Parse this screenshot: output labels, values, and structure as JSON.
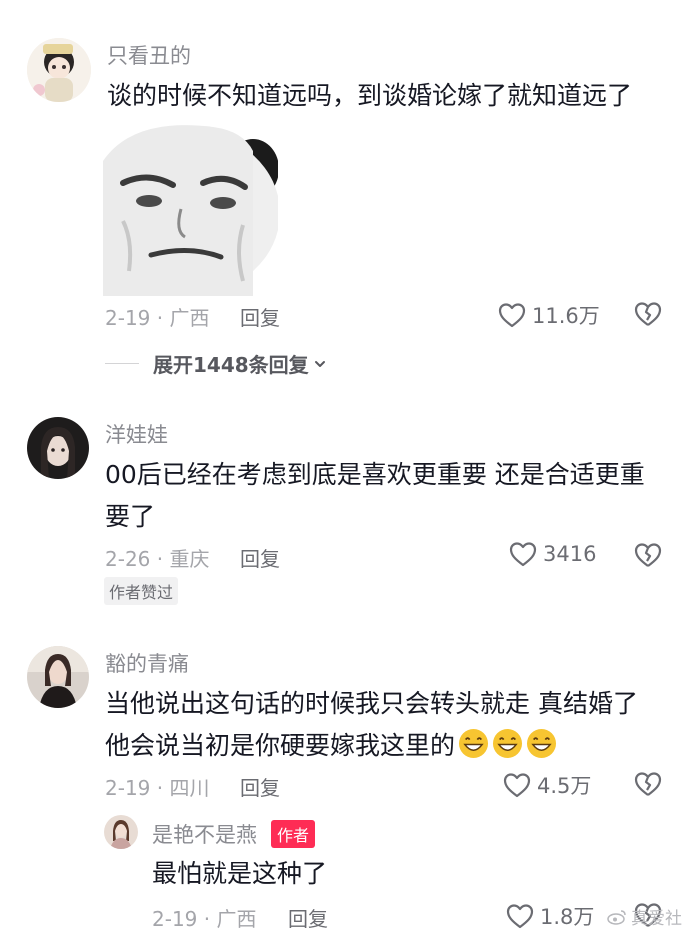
{
  "comments": [
    {
      "username": "只看丑的",
      "text": "谈的时候不知道远吗，到谈婚论嫁了就知道远了",
      "date_location": "2-19 · 广西",
      "reply_label": "回复",
      "like_count": "11.6万",
      "sticker": "panda-meme-sticker",
      "expand_label": "展开1448条回复"
    },
    {
      "username": "洋娃娃",
      "text_line1": "00后已经在考虑到底是喜欢更重要 还是合适更重",
      "text_line2": "要了",
      "date_location": "2-26 · 重庆",
      "reply_label": "回复",
      "like_count": "3416",
      "badge": "作者赞过"
    },
    {
      "username": "豁的青痛",
      "text_line1": "当他说出这句话的时候我只会转头就走 真结婚了",
      "text_line2": "他会说当初是你硬要嫁我这里的",
      "emoji": [
        "grin-emoji",
        "grin-emoji",
        "grin-emoji"
      ],
      "date_location": "2-19 · 四川",
      "reply_label": "回复",
      "like_count": "4.5万"
    }
  ],
  "reply": {
    "username": "是艳不是燕",
    "author_badge": "作者",
    "text": "最怕就是这种了",
    "date_location": "2-19 · 广西",
    "reply_label": "回复",
    "like_count": "1.8万"
  },
  "watermark": "真爱社",
  "colors": {
    "accent": "#fe2c55",
    "text": "#161823",
    "muted": "#a4a5aa"
  }
}
